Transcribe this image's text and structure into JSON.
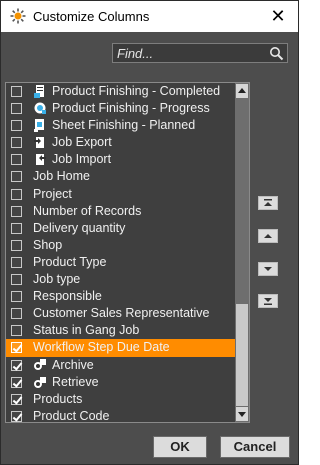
{
  "window": {
    "title": "Customize Columns",
    "close_glyph": "✕"
  },
  "search": {
    "placeholder": "Find...",
    "icon": "search-icon"
  },
  "columns": [
    {
      "label": "Product Finishing - Completed",
      "checked": false,
      "icon": "finishing-completed-icon"
    },
    {
      "label": "Product Finishing - Progress",
      "checked": false,
      "icon": "finishing-progress-icon"
    },
    {
      "label": "Sheet Finishing - Planned",
      "checked": false,
      "icon": "sheet-finishing-icon"
    },
    {
      "label": "Job Export",
      "checked": false,
      "icon": "job-export-icon"
    },
    {
      "label": "Job Import",
      "checked": false,
      "icon": "job-import-icon"
    },
    {
      "label": "Job Home",
      "checked": false
    },
    {
      "label": "Project",
      "checked": false
    },
    {
      "label": "Number of Records",
      "checked": false
    },
    {
      "label": "Delivery quantity",
      "checked": false
    },
    {
      "label": "Shop",
      "checked": false
    },
    {
      "label": "Product Type",
      "checked": false
    },
    {
      "label": "Job type",
      "checked": false
    },
    {
      "label": "Responsible",
      "checked": false
    },
    {
      "label": "Customer Sales Representative",
      "checked": false
    },
    {
      "label": "Status in Gang Job",
      "checked": false
    },
    {
      "label": "Workflow Step Due Date",
      "checked": true,
      "selected": true
    },
    {
      "label": "Archive",
      "checked": true,
      "icon": "archive-icon"
    },
    {
      "label": "Retrieve",
      "checked": true,
      "icon": "retrieve-icon"
    },
    {
      "label": "Products",
      "checked": true
    },
    {
      "label": "Product Code",
      "checked": true
    }
  ],
  "move_buttons": [
    "move-to-top-icon",
    "move-up-icon",
    "move-down-icon",
    "move-to-bottom-icon"
  ],
  "buttons": {
    "ok": "OK",
    "cancel": "Cancel"
  },
  "colors": {
    "selection": "#ff8c00",
    "background": "#4d4d4d",
    "list_background": "#3f3f3f"
  }
}
